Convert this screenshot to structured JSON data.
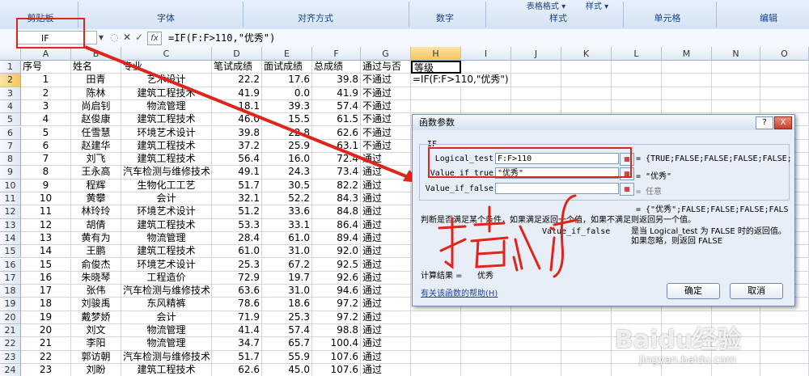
{
  "ribbon": {
    "groups": [
      "剪贴板",
      "字体",
      "对齐方式",
      "数字",
      "样式",
      "单元格",
      "编辑"
    ],
    "style_items": [
      "表格格式 ▾",
      "样式 ▾"
    ]
  },
  "formula_bar": {
    "name_box": "IF",
    "fx_label": "fx",
    "formula": "=IF(F:F>110,\"优秀\")"
  },
  "columns": [
    "A",
    "B",
    "C",
    "D",
    "E",
    "F",
    "G",
    "H",
    "I",
    "J",
    "K",
    "L",
    "M",
    "N",
    "O"
  ],
  "table": {
    "headers": [
      "序号",
      "姓名",
      "专业",
      "笔试成绩",
      "面试成绩",
      "总成绩",
      "通过与否",
      "等级"
    ],
    "rows": [
      [
        "1",
        "田青",
        "艺术设计",
        "22.2",
        "17.6",
        "39.8",
        "不通过"
      ],
      [
        "2",
        "陈林",
        "建筑工程技术",
        "41.9",
        "0.0",
        "41.9",
        "不通过"
      ],
      [
        "3",
        "尚启钊",
        "物流管理",
        "18.1",
        "39.3",
        "57.4",
        "不通过"
      ],
      [
        "4",
        "赵俊康",
        "建筑工程技术",
        "46.0",
        "15.5",
        "61.5",
        "不通过"
      ],
      [
        "5",
        "任雪慧",
        "环境艺术设计",
        "39.8",
        "22.8",
        "62.6",
        "不通过"
      ],
      [
        "6",
        "赵建华",
        "建筑工程技术",
        "37.2",
        "25.9",
        "63.1",
        "不通过"
      ],
      [
        "7",
        "刘飞",
        "建筑工程技术",
        "56.4",
        "16.0",
        "72.4",
        "通过"
      ],
      [
        "8",
        "王永高",
        "汽车检测与维修技术",
        "49.1",
        "24.3",
        "73.4",
        "通过"
      ],
      [
        "9",
        "程辉",
        "生物化工工艺",
        "51.7",
        "30.5",
        "82.2",
        "通过"
      ],
      [
        "10",
        "黄攀",
        "会计",
        "32.1",
        "52.2",
        "84.3",
        "通过"
      ],
      [
        "11",
        "林玲玲",
        "环境艺术设计",
        "51.2",
        "33.6",
        "84.8",
        "通过"
      ],
      [
        "12",
        "胡倩",
        "建筑工程技术",
        "53.3",
        "33.1",
        "86.4",
        "通过"
      ],
      [
        "13",
        "黄有为",
        "物流管理",
        "28.4",
        "61.0",
        "89.4",
        "通过"
      ],
      [
        "14",
        "王鹏",
        "建筑工程技术",
        "61.0",
        "31.0",
        "92.0",
        "通过"
      ],
      [
        "15",
        "俞俊杰",
        "环境艺术设计",
        "25.3",
        "67.2",
        "92.5",
        "通过"
      ],
      [
        "16",
        "朱晓琴",
        "工程造价",
        "72.9",
        "19.7",
        "92.6",
        "通过"
      ],
      [
        "17",
        "张伟",
        "汽车检测与维修技术",
        "63.6",
        "31.0",
        "94.6",
        "通过"
      ],
      [
        "18",
        "刘骏禹",
        "东风精裤",
        "78.6",
        "18.6",
        "97.2",
        "通过"
      ],
      [
        "19",
        "戴梦娇",
        "会计",
        "71.9",
        "25.3",
        "97.2",
        "通过"
      ],
      [
        "20",
        "刘文",
        "物流管理",
        "41.4",
        "57.4",
        "98.8",
        "通过"
      ],
      [
        "21",
        "李阳",
        "物流管理",
        "34.7",
        "65.7",
        "100.4",
        "通过"
      ],
      [
        "22",
        "郭访朝",
        "汽车检测与维修技术",
        "51.7",
        "55.9",
        "107.6",
        "通过"
      ],
      [
        "23",
        "刘盼",
        "建筑工程技术",
        "62.6",
        "45.0",
        "107.6",
        "通过"
      ]
    ],
    "h2_editing": "=IF(F:F>110,\"优秀\")"
  },
  "dialog": {
    "title": "函数参数",
    "help_btn": "?",
    "close_btn": "X",
    "func_name": "IF",
    "args": [
      {
        "label": "Logical_test",
        "value": "F:F>110",
        "result": "= {TRUE;FALSE;FALSE;FALSE;FALSE;"
      },
      {
        "label": "Value_if_true",
        "value": "\"优秀\"",
        "result": "= \"优秀\""
      },
      {
        "label": "Value_if_false",
        "value": "",
        "result": "= 任意"
      }
    ],
    "overall_result": "= {\"优秀\";FALSE;FALSE;FALSE;FALS",
    "description": "判断是否满足某个条件，如果满足返回一个值，如果不满足则返回另一个值。",
    "arg_help_name": "Value_if_false",
    "arg_help_text": "是当 Logical_test 为 FALSE 时的返回值。如果忽略，则返回 FALSE",
    "calc_label": "计算结果 =",
    "calc_value": "优秀",
    "help_link": "有关该函数的帮助(H)",
    "ok": "确定",
    "cancel": "取消"
  },
  "annotation": {
    "handwriting": "插入if",
    "color": "#e0241b"
  },
  "watermark": {
    "brand": "Baidu经验",
    "url": "jingyan.baidu.com"
  }
}
